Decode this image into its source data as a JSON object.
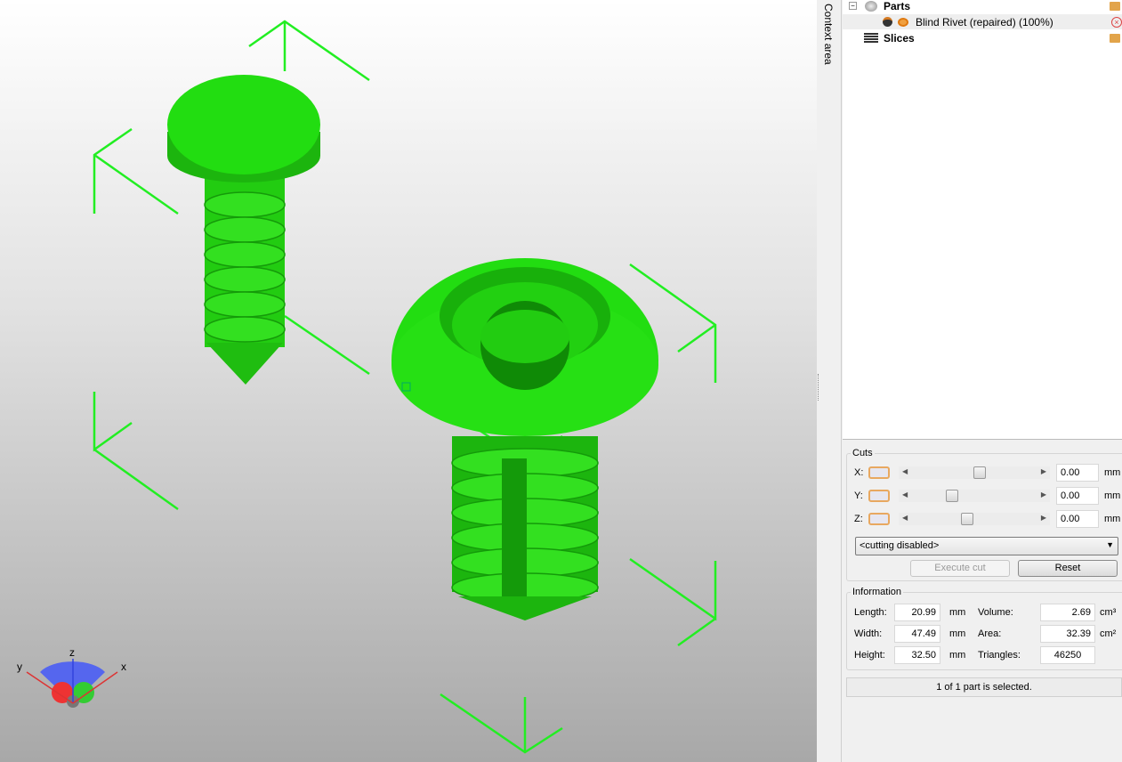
{
  "context_area_label": "Context area",
  "tree": {
    "parts_label": "Parts",
    "part_name": "Blind Rivet (repaired) (100%)",
    "slices_label": "Slices"
  },
  "cuts": {
    "title": "Cuts",
    "rows": [
      {
        "axis": "X:",
        "value": "0.00",
        "unit": "mm",
        "slider_fraction": 0.52
      },
      {
        "axis": "Y:",
        "value": "0.00",
        "unit": "mm",
        "slider_fraction": 0.3
      },
      {
        "axis": "Z:",
        "value": "0.00",
        "unit": "mm",
        "slider_fraction": 0.42
      }
    ],
    "mode": "<cutting disabled>",
    "execute_label": "Execute cut",
    "reset_label": "Reset"
  },
  "info": {
    "title": "Information",
    "length_label": "Length:",
    "length": "20.99",
    "length_unit": "mm",
    "width_label": "Width:",
    "width": "47.49",
    "width_unit": "mm",
    "height_label": "Height:",
    "height": "32.50",
    "height_unit": "mm",
    "volume_label": "Volume:",
    "volume": "2.69",
    "volume_unit": "cm³",
    "area_label": "Area:",
    "area": "32.39",
    "area_unit": "cm²",
    "triangles_label": "Triangles:",
    "triangles": "46250"
  },
  "status": "1 of 1 part is selected.",
  "axes": {
    "x": "x",
    "y": "y",
    "z": "z"
  },
  "colors": {
    "model": "#22dd11",
    "bbox": "#22ee22"
  }
}
